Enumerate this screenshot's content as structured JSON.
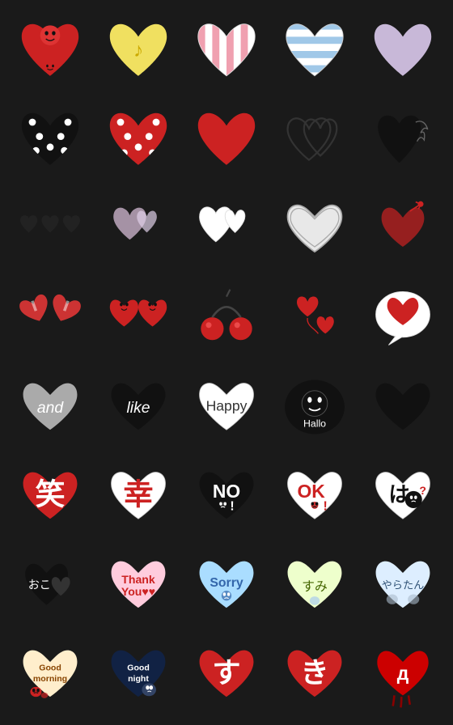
{
  "stickers": [
    {
      "id": 1,
      "desc": "red-heart-face",
      "row": 1,
      "col": 1
    },
    {
      "id": 2,
      "desc": "yellow-heart-music",
      "row": 1,
      "col": 2
    },
    {
      "id": 3,
      "desc": "pink-striped-heart",
      "row": 1,
      "col": 3
    },
    {
      "id": 4,
      "desc": "blue-striped-heart",
      "row": 1,
      "col": 4
    },
    {
      "id": 5,
      "desc": "lavender-heart",
      "row": 1,
      "col": 5
    },
    {
      "id": 6,
      "desc": "black-polka-dot-heart",
      "row": 2,
      "col": 1
    },
    {
      "id": 7,
      "desc": "red-polka-dot-heart",
      "row": 2,
      "col": 2
    },
    {
      "id": 8,
      "desc": "solid-red-heart",
      "row": 2,
      "col": 3
    },
    {
      "id": 9,
      "desc": "double-outline-hearts",
      "row": 2,
      "col": 4
    },
    {
      "id": 10,
      "desc": "black-heart-feather",
      "row": 2,
      "col": 5
    },
    {
      "id": 11,
      "desc": "three-small-hearts",
      "row": 3,
      "col": 1
    },
    {
      "id": 12,
      "desc": "two-light-hearts",
      "row": 3,
      "col": 2
    },
    {
      "id": 13,
      "desc": "two-white-hearts",
      "row": 3,
      "col": 3
    },
    {
      "id": 14,
      "desc": "grey-outlined-heart",
      "row": 3,
      "col": 4
    },
    {
      "id": 15,
      "desc": "red-heart-arrow",
      "row": 3,
      "col": 5
    },
    {
      "id": 16,
      "desc": "candy-hearts",
      "row": 4,
      "col": 1
    },
    {
      "id": 17,
      "desc": "red-face-hearts",
      "row": 4,
      "col": 2
    },
    {
      "id": 18,
      "desc": "cherries",
      "row": 4,
      "col": 3
    },
    {
      "id": 19,
      "desc": "red-falling-hearts",
      "row": 4,
      "col": 4
    },
    {
      "id": 20,
      "desc": "speech-bubble-heart",
      "row": 4,
      "col": 5
    },
    {
      "id": 21,
      "desc": "grey-and-text",
      "row": 5,
      "col": 1
    },
    {
      "id": 22,
      "desc": "black-like-text",
      "row": 5,
      "col": 2
    },
    {
      "id": 23,
      "desc": "white-happy-text",
      "row": 5,
      "col": 3
    },
    {
      "id": 24,
      "desc": "black-hallo-text",
      "row": 5,
      "col": 4
    },
    {
      "id": 25,
      "desc": "solid-black-heart",
      "row": 5,
      "col": 5
    },
    {
      "id": 26,
      "desc": "kanji-laugh-red",
      "row": 6,
      "col": 1
    },
    {
      "id": 27,
      "desc": "kanji-happiness",
      "row": 6,
      "col": 2
    },
    {
      "id": 28,
      "desc": "no-text-heart",
      "row": 6,
      "col": 3
    },
    {
      "id": 29,
      "desc": "ok-text-heart",
      "row": 6,
      "col": 4
    },
    {
      "id": 30,
      "desc": "ha-question-heart",
      "row": 6,
      "col": 5
    },
    {
      "id": 31,
      "desc": "oko-black-hearts",
      "row": 7,
      "col": 1
    },
    {
      "id": 32,
      "desc": "thank-you-heart",
      "row": 7,
      "col": 2
    },
    {
      "id": 33,
      "desc": "sorry-heart",
      "row": 7,
      "col": 3
    },
    {
      "id": 34,
      "desc": "sumimasen-heart",
      "row": 7,
      "col": 4
    },
    {
      "id": 35,
      "desc": "yaratan-heart",
      "row": 7,
      "col": 5
    },
    {
      "id": 36,
      "desc": "good-morning-heart",
      "row": 8,
      "col": 1
    },
    {
      "id": 37,
      "desc": "good-night-heart",
      "row": 8,
      "col": 2
    },
    {
      "id": 38,
      "desc": "su-kanji-heart",
      "row": 8,
      "col": 3
    },
    {
      "id": 39,
      "desc": "ki-kanji-heart",
      "row": 8,
      "col": 4
    },
    {
      "id": 40,
      "desc": "bloody-heart",
      "row": 8,
      "col": 5
    }
  ]
}
